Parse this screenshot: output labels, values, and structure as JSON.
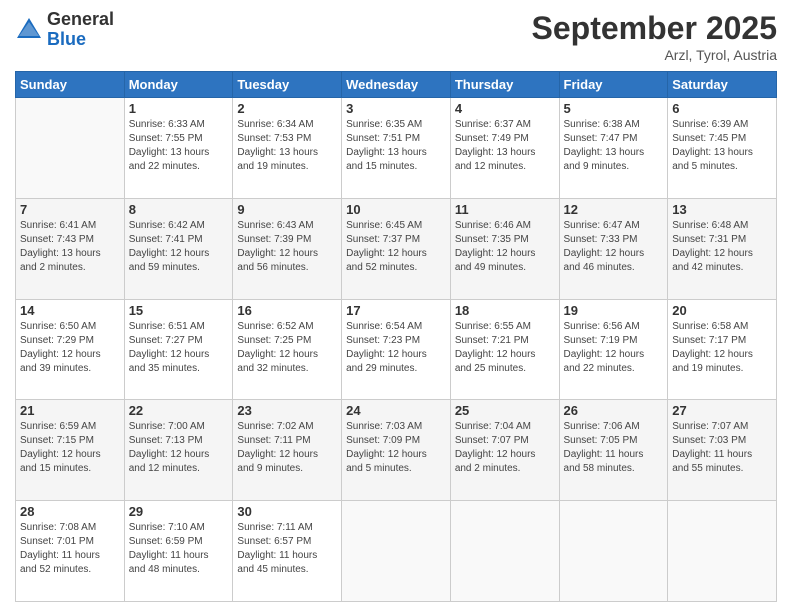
{
  "header": {
    "logo_general": "General",
    "logo_blue": "Blue",
    "month_title": "September 2025",
    "location": "Arzl, Tyrol, Austria"
  },
  "weekdays": [
    "Sunday",
    "Monday",
    "Tuesday",
    "Wednesday",
    "Thursday",
    "Friday",
    "Saturday"
  ],
  "weeks": [
    [
      {
        "day": "",
        "info": ""
      },
      {
        "day": "1",
        "info": "Sunrise: 6:33 AM\nSunset: 7:55 PM\nDaylight: 13 hours\nand 22 minutes."
      },
      {
        "day": "2",
        "info": "Sunrise: 6:34 AM\nSunset: 7:53 PM\nDaylight: 13 hours\nand 19 minutes."
      },
      {
        "day": "3",
        "info": "Sunrise: 6:35 AM\nSunset: 7:51 PM\nDaylight: 13 hours\nand 15 minutes."
      },
      {
        "day": "4",
        "info": "Sunrise: 6:37 AM\nSunset: 7:49 PM\nDaylight: 13 hours\nand 12 minutes."
      },
      {
        "day": "5",
        "info": "Sunrise: 6:38 AM\nSunset: 7:47 PM\nDaylight: 13 hours\nand 9 minutes."
      },
      {
        "day": "6",
        "info": "Sunrise: 6:39 AM\nSunset: 7:45 PM\nDaylight: 13 hours\nand 5 minutes."
      }
    ],
    [
      {
        "day": "7",
        "info": "Sunrise: 6:41 AM\nSunset: 7:43 PM\nDaylight: 13 hours\nand 2 minutes."
      },
      {
        "day": "8",
        "info": "Sunrise: 6:42 AM\nSunset: 7:41 PM\nDaylight: 12 hours\nand 59 minutes."
      },
      {
        "day": "9",
        "info": "Sunrise: 6:43 AM\nSunset: 7:39 PM\nDaylight: 12 hours\nand 56 minutes."
      },
      {
        "day": "10",
        "info": "Sunrise: 6:45 AM\nSunset: 7:37 PM\nDaylight: 12 hours\nand 52 minutes."
      },
      {
        "day": "11",
        "info": "Sunrise: 6:46 AM\nSunset: 7:35 PM\nDaylight: 12 hours\nand 49 minutes."
      },
      {
        "day": "12",
        "info": "Sunrise: 6:47 AM\nSunset: 7:33 PM\nDaylight: 12 hours\nand 46 minutes."
      },
      {
        "day": "13",
        "info": "Sunrise: 6:48 AM\nSunset: 7:31 PM\nDaylight: 12 hours\nand 42 minutes."
      }
    ],
    [
      {
        "day": "14",
        "info": "Sunrise: 6:50 AM\nSunset: 7:29 PM\nDaylight: 12 hours\nand 39 minutes."
      },
      {
        "day": "15",
        "info": "Sunrise: 6:51 AM\nSunset: 7:27 PM\nDaylight: 12 hours\nand 35 minutes."
      },
      {
        "day": "16",
        "info": "Sunrise: 6:52 AM\nSunset: 7:25 PM\nDaylight: 12 hours\nand 32 minutes."
      },
      {
        "day": "17",
        "info": "Sunrise: 6:54 AM\nSunset: 7:23 PM\nDaylight: 12 hours\nand 29 minutes."
      },
      {
        "day": "18",
        "info": "Sunrise: 6:55 AM\nSunset: 7:21 PM\nDaylight: 12 hours\nand 25 minutes."
      },
      {
        "day": "19",
        "info": "Sunrise: 6:56 AM\nSunset: 7:19 PM\nDaylight: 12 hours\nand 22 minutes."
      },
      {
        "day": "20",
        "info": "Sunrise: 6:58 AM\nSunset: 7:17 PM\nDaylight: 12 hours\nand 19 minutes."
      }
    ],
    [
      {
        "day": "21",
        "info": "Sunrise: 6:59 AM\nSunset: 7:15 PM\nDaylight: 12 hours\nand 15 minutes."
      },
      {
        "day": "22",
        "info": "Sunrise: 7:00 AM\nSunset: 7:13 PM\nDaylight: 12 hours\nand 12 minutes."
      },
      {
        "day": "23",
        "info": "Sunrise: 7:02 AM\nSunset: 7:11 PM\nDaylight: 12 hours\nand 9 minutes."
      },
      {
        "day": "24",
        "info": "Sunrise: 7:03 AM\nSunset: 7:09 PM\nDaylight: 12 hours\nand 5 minutes."
      },
      {
        "day": "25",
        "info": "Sunrise: 7:04 AM\nSunset: 7:07 PM\nDaylight: 12 hours\nand 2 minutes."
      },
      {
        "day": "26",
        "info": "Sunrise: 7:06 AM\nSunset: 7:05 PM\nDaylight: 11 hours\nand 58 minutes."
      },
      {
        "day": "27",
        "info": "Sunrise: 7:07 AM\nSunset: 7:03 PM\nDaylight: 11 hours\nand 55 minutes."
      }
    ],
    [
      {
        "day": "28",
        "info": "Sunrise: 7:08 AM\nSunset: 7:01 PM\nDaylight: 11 hours\nand 52 minutes."
      },
      {
        "day": "29",
        "info": "Sunrise: 7:10 AM\nSunset: 6:59 PM\nDaylight: 11 hours\nand 48 minutes."
      },
      {
        "day": "30",
        "info": "Sunrise: 7:11 AM\nSunset: 6:57 PM\nDaylight: 11 hours\nand 45 minutes."
      },
      {
        "day": "",
        "info": ""
      },
      {
        "day": "",
        "info": ""
      },
      {
        "day": "",
        "info": ""
      },
      {
        "day": "",
        "info": ""
      }
    ]
  ]
}
